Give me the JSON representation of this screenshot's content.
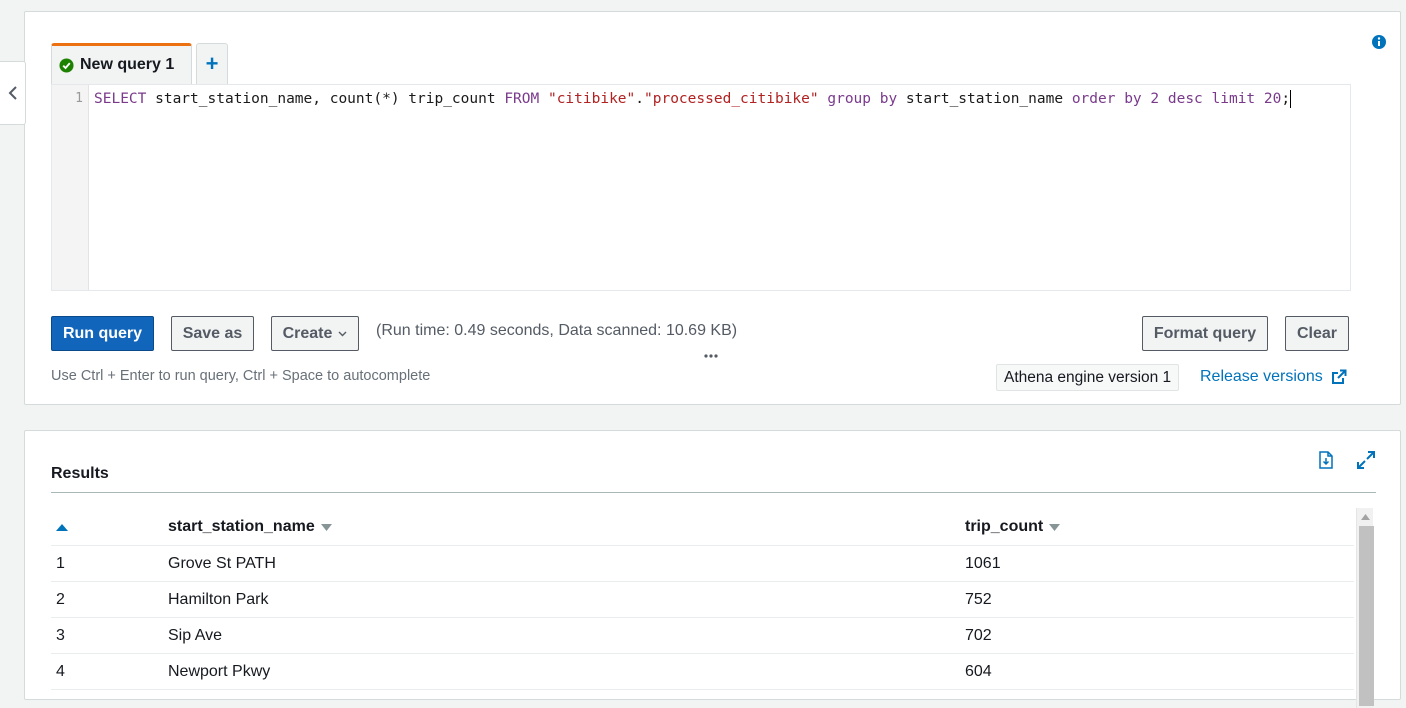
{
  "editor": {
    "tab_label": "New query 1",
    "add_tab_label": "+",
    "line_number": "1",
    "code": {
      "select": "SELECT",
      "cols": " start_station_name, count(*) trip_count ",
      "from": "FROM",
      "db": "\"citibike\"",
      "dot": ".",
      "table": "\"processed_citibike\"",
      "group": "group by",
      "groupcol": " start_station_name ",
      "order": "order by",
      "num": "2",
      "desc": "desc",
      "limit": "limit",
      "limitnum": "20",
      "semicolon": ";"
    },
    "buttons": {
      "run": "Run query",
      "save": "Save as",
      "create": "Create",
      "format": "Format query",
      "clear": "Clear"
    },
    "run_info": "(Run time: 0.49 seconds, Data scanned: 10.69 KB)",
    "hint": "Use Ctrl + Enter to run query, Ctrl + Space to autocomplete",
    "engine_version": "Athena engine version 1",
    "release_link": "Release versions"
  },
  "results": {
    "title": "Results",
    "columns": [
      "start_station_name",
      "trip_count"
    ],
    "rows": [
      {
        "n": "1",
        "station": "Grove St PATH",
        "count": "1061"
      },
      {
        "n": "2",
        "station": "Hamilton Park",
        "count": "752"
      },
      {
        "n": "3",
        "station": "Sip Ave",
        "count": "702"
      },
      {
        "n": "4",
        "station": "Newport Pkwy",
        "count": "604"
      }
    ]
  },
  "colors": {
    "primary": "#1166bb",
    "link": "#0073bb",
    "tab_accent": "#ec7211",
    "success": "#1d8102"
  },
  "icons": {
    "collapse": "chevron-left-icon",
    "info": "info-icon",
    "tab_status": "check-circle-icon",
    "dropdown": "caret-down-icon",
    "external": "external-link-icon",
    "download": "download-icon",
    "expand": "expand-icon",
    "sort": "sort-icon"
  }
}
